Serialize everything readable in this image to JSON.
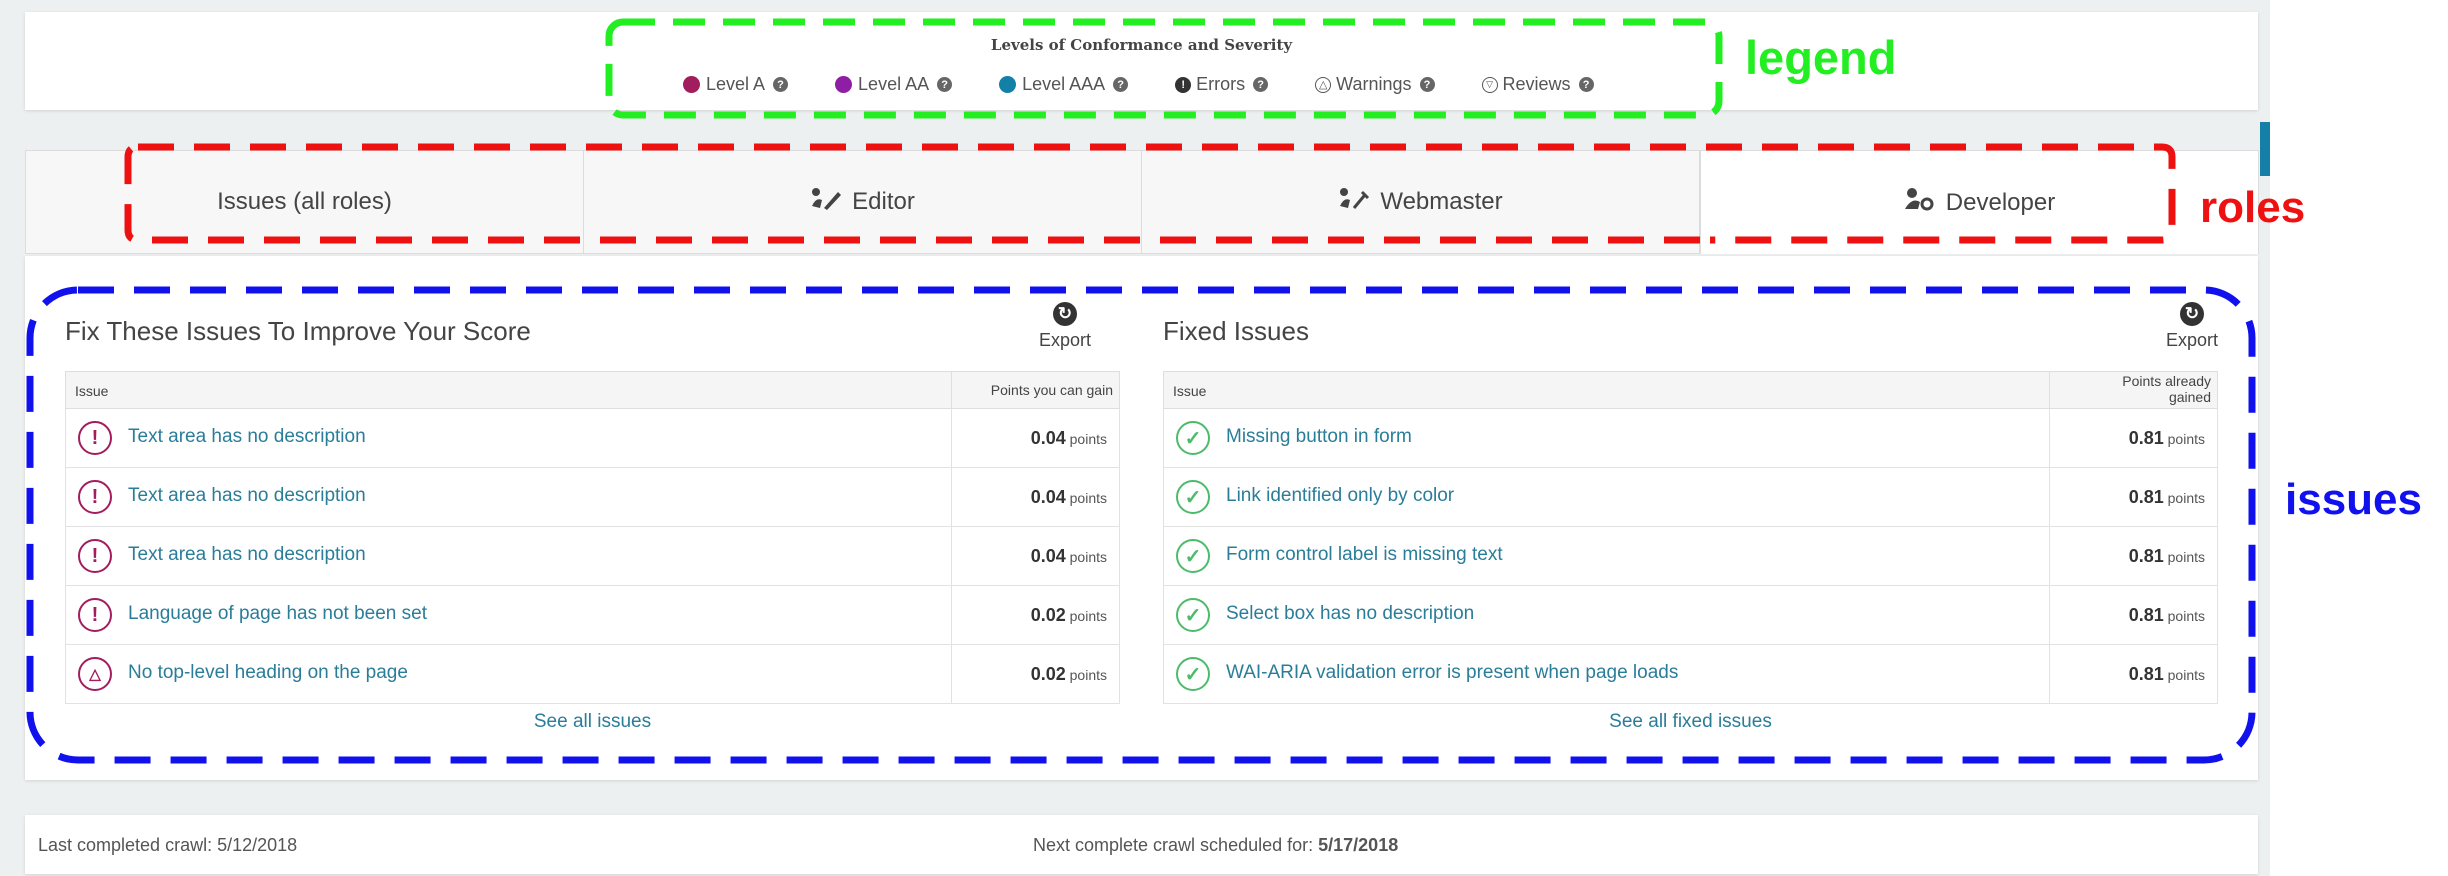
{
  "legend": {
    "title": "Levels of Conformance and Severity",
    "items": [
      {
        "label": "Level A",
        "color": "#a11d5e",
        "icon": "level-a-dot"
      },
      {
        "label": "Level AA",
        "color": "#8e1fa4",
        "icon": "level-aa-dot"
      },
      {
        "label": "Level AAA",
        "color": "#1480a8",
        "icon": "level-aaa-dot"
      },
      {
        "label": "Errors",
        "icon": "error-icon"
      },
      {
        "label": "Warnings",
        "icon": "warning-icon"
      },
      {
        "label": "Reviews",
        "icon": "review-icon"
      }
    ]
  },
  "tabs": [
    {
      "label": "Issues (all roles)",
      "icon": ""
    },
    {
      "label": "Editor",
      "icon": "editor-icon"
    },
    {
      "label": "Webmaster",
      "icon": "webmaster-icon"
    },
    {
      "label": "Developer",
      "icon": "developer-icon",
      "active": true
    }
  ],
  "fix_panel": {
    "title": "Fix These Issues To Improve Your Score",
    "export_label": "Export",
    "col_issue": "Issue",
    "col_points": "Points you can gain",
    "rows": [
      {
        "text": "Text area has no description",
        "value": "0.04",
        "unit": "points",
        "icon": "error-icon"
      },
      {
        "text": "Text area has no description",
        "value": "0.04",
        "unit": "points",
        "icon": "error-icon"
      },
      {
        "text": "Text area has no description",
        "value": "0.04",
        "unit": "points",
        "icon": "error-icon"
      },
      {
        "text": "Language of page has not been set",
        "value": "0.02",
        "unit": "points",
        "icon": "error-icon"
      },
      {
        "text": "No top-level heading on the page",
        "value": "0.02",
        "unit": "points",
        "icon": "warning-icon"
      }
    ],
    "see_all": "See all issues"
  },
  "fixed_panel": {
    "title": "Fixed Issues",
    "export_label": "Export",
    "col_issue": "Issue",
    "col_points_line1": "Points already",
    "col_points_line2": "gained",
    "rows": [
      {
        "text": "Missing button in form",
        "value": "0.81",
        "unit": "points",
        "icon": "check-icon"
      },
      {
        "text": "Link identified only by color",
        "value": "0.81",
        "unit": "points",
        "icon": "check-icon"
      },
      {
        "text": "Form control label is missing text",
        "value": "0.81",
        "unit": "points",
        "icon": "check-icon"
      },
      {
        "text": "Select box has no description",
        "value": "0.81",
        "unit": "points",
        "icon": "check-icon"
      },
      {
        "text": "WAI-ARIA validation error is present when page loads",
        "value": "0.81",
        "unit": "points",
        "icon": "check-icon"
      }
    ],
    "see_all": "See all fixed issues"
  },
  "footer": {
    "last_crawl": "Last completed crawl: 5/12/2018",
    "next_crawl_label": "Next complete crawl scheduled for: ",
    "next_crawl_date": "5/17/2018"
  },
  "annotations": {
    "legend": {
      "label": "legend",
      "color": "#22ee22"
    },
    "roles": {
      "label": "roles",
      "color": "#ee1111"
    },
    "issues": {
      "label": "issues",
      "color": "#1111ee"
    }
  },
  "colors": {
    "link": "#2a7d99",
    "error": "#a11d5e",
    "success": "#4cbb6a",
    "accent": "#1480a8"
  }
}
